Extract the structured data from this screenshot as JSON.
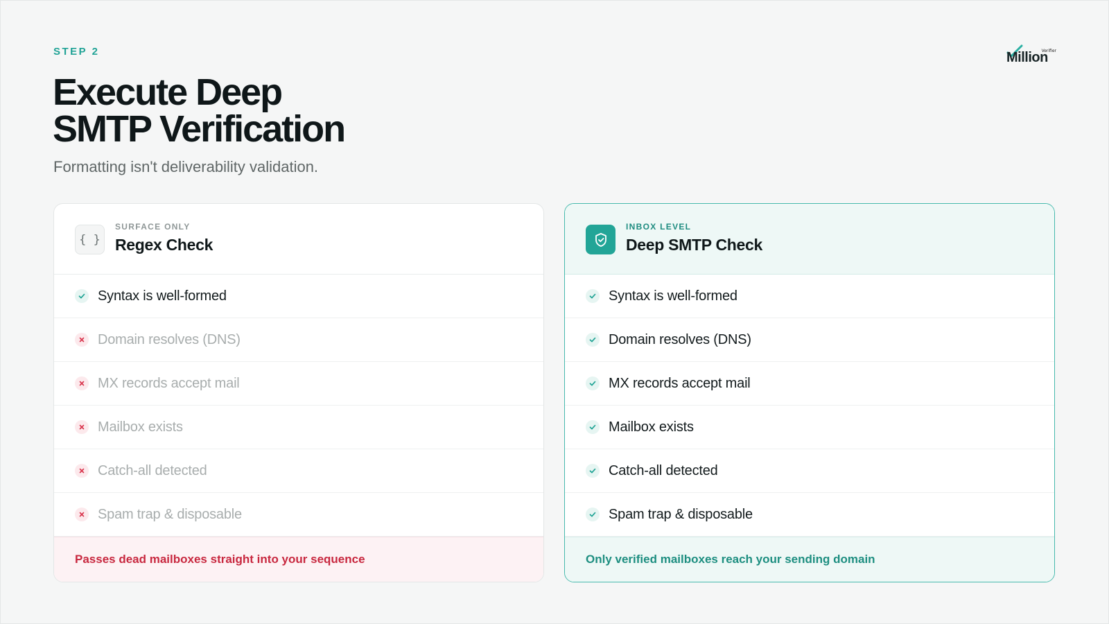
{
  "header": {
    "step": "STEP 2",
    "title_line1": "Execute Deep",
    "title_line2": "SMTP Verification",
    "subtitle": "Formatting isn't deliverability validation."
  },
  "logo": {
    "name": "Million",
    "tagline": "Verifier"
  },
  "cards": {
    "left": {
      "kicker": "SURFACE ONLY",
      "title": "Regex Check",
      "icon": "braces-icon",
      "icon_glyph": "{ }",
      "footer": "Passes dead mailboxes straight into your sequence",
      "rows": [
        {
          "label": "Syntax is well-formed",
          "status": "pass"
        },
        {
          "label": "Domain resolves (DNS)",
          "status": "fail"
        },
        {
          "label": "MX records accept mail",
          "status": "fail"
        },
        {
          "label": "Mailbox exists",
          "status": "fail"
        },
        {
          "label": "Catch-all detected",
          "status": "fail"
        },
        {
          "label": "Spam trap & disposable",
          "status": "fail"
        }
      ]
    },
    "right": {
      "kicker": "INBOX LEVEL",
      "title": "Deep SMTP Check",
      "icon": "shield-check-icon",
      "footer": "Only verified mailboxes reach your sending domain",
      "rows": [
        {
          "label": "Syntax is well-formed",
          "status": "pass"
        },
        {
          "label": "Domain resolves (DNS)",
          "status": "pass"
        },
        {
          "label": "MX records accept mail",
          "status": "pass"
        },
        {
          "label": "Mailbox exists",
          "status": "pass"
        },
        {
          "label": "Catch-all detected",
          "status": "pass"
        },
        {
          "label": "Spam trap & disposable",
          "status": "pass"
        }
      ]
    }
  },
  "colors": {
    "accent": "#21a396",
    "fail": "#c8283f",
    "text": "#0f1719"
  }
}
